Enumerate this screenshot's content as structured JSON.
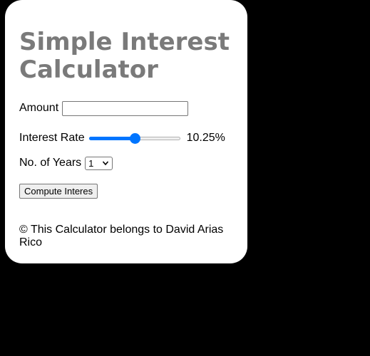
{
  "page": {
    "title_line1": "Simple Interest",
    "title_line2": "Calculator"
  },
  "form": {
    "amount_label": "Amount",
    "amount_value": "",
    "rate_label": "Interest Rate",
    "rate_value_text": "10.25%",
    "rate_slider_fraction": 0.5,
    "years_label": "No. of Years",
    "years_selected": "1",
    "compute_label": "Compute Interes"
  },
  "footer": {
    "text": "© This Calculator belongs to David Arias Rico"
  },
  "colors": {
    "background": "#000000",
    "card": "#ffffff",
    "title": "#7a7a7a",
    "accent": "#0075ff"
  }
}
